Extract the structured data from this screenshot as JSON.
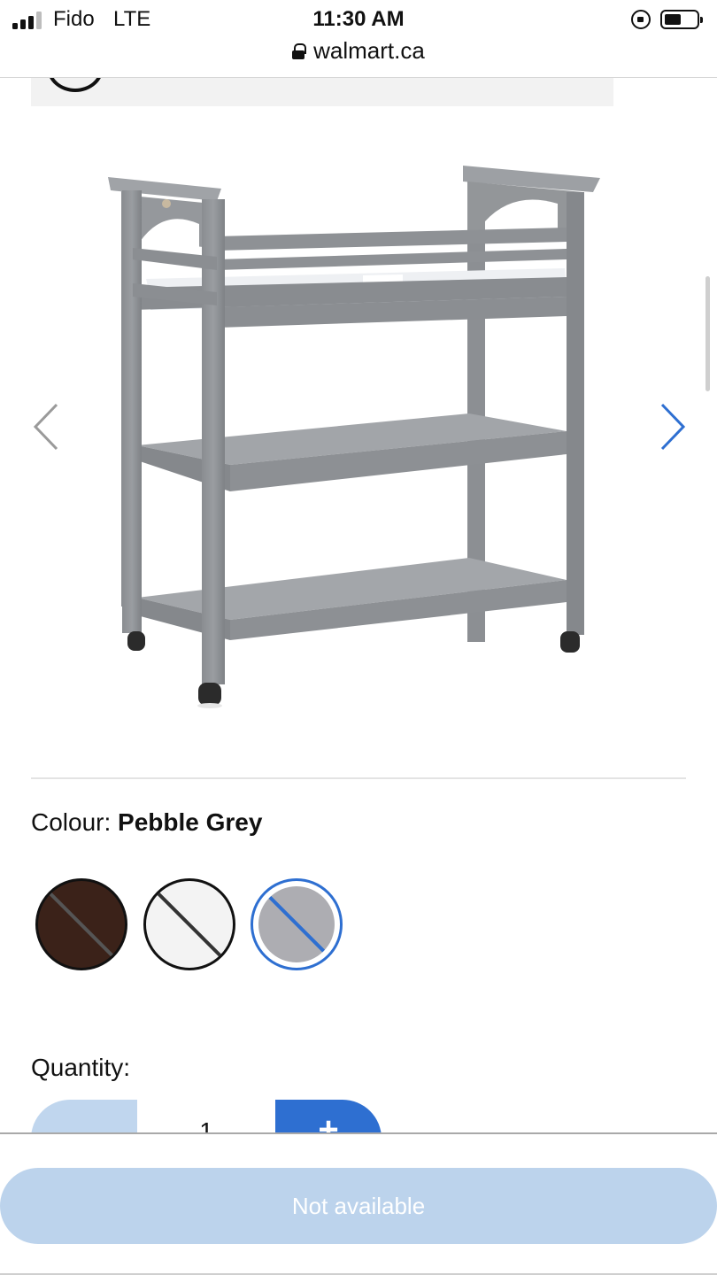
{
  "status_bar": {
    "carrier": "Fido",
    "network": "LTE",
    "time": "11:30 AM",
    "url": "walmart.ca"
  },
  "product": {
    "image": "changing-table-pebble-grey",
    "prev_icon": "chevron-left-icon",
    "next_icon": "chevron-right-icon"
  },
  "colour": {
    "label": "Colour:",
    "selected": "Pebble Grey",
    "swatches": [
      {
        "color": "#3b2219",
        "selected": false
      },
      {
        "color": "#f3f3f3",
        "selected": false
      },
      {
        "color": "#adadb2",
        "selected": true
      }
    ],
    "selected_border_color": "#2e6fd1"
  },
  "quantity": {
    "label": "Quantity:",
    "value": "1",
    "minus_label": "−",
    "plus_label": "+"
  },
  "cta": {
    "label": "Not available",
    "color": "#bcd3ec"
  }
}
